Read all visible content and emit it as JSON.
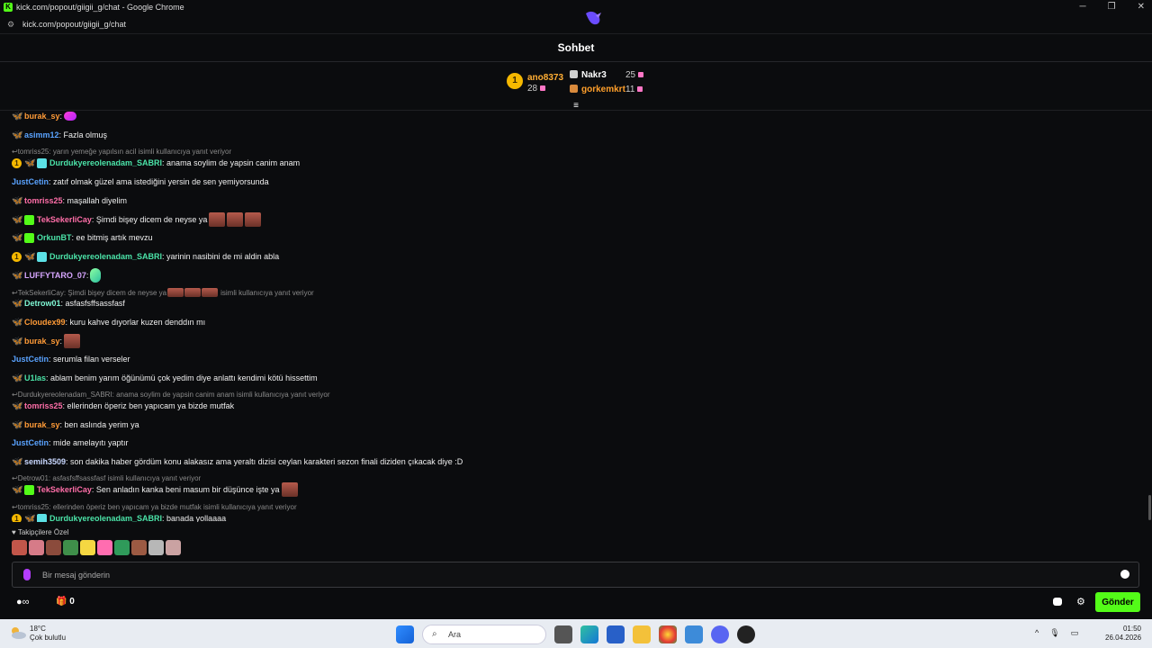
{
  "window": {
    "title": "kick.com/popout/giigii_g/chat - Google Chrome",
    "url": "kick.com/popout/giigii_g/chat"
  },
  "chat_header": {
    "title": "Sohbet"
  },
  "leaderboard": {
    "first": {
      "rank": "1",
      "name": "ano8373",
      "count": "28"
    },
    "others": [
      {
        "name": "Nakr3",
        "count": "25",
        "color": "#ffffff"
      },
      {
        "name": "gorkemkrt",
        "count": "11",
        "color": "#ff9f2b"
      }
    ]
  },
  "messages": [
    {
      "kind": "msg",
      "badges": [
        "fly"
      ],
      "user": "burak_sy",
      "color": "#ff9b37",
      "text": ":",
      "emotes": [
        "p"
      ]
    },
    {
      "kind": "msg",
      "badges": [
        "fly-y"
      ],
      "user": "asimm12",
      "color": "#5aa3ff",
      "text": ": Fazla olmuş",
      "emotes": []
    },
    {
      "kind": "reply",
      "text": "tomriss25: yarın yemeğe yapılsın acil isimli kullanıcıya yanıt veriyor",
      "emotes": []
    },
    {
      "kind": "msg",
      "badges": [
        "one",
        "fly-o",
        "sub"
      ],
      "user": "Durdukyereolenadam_SABRI",
      "color": "#4be3a8",
      "text": ": anama soylim de yapsin canim anam",
      "emotes": []
    },
    {
      "kind": "msg",
      "badges": [],
      "user": "JustCetin",
      "color": "#5aa3ff",
      "text": ": zatıf olmak güzel ama istediğini yersin de sen yemiyorsunda",
      "emotes": []
    },
    {
      "kind": "msg",
      "badges": [
        "fly-y"
      ],
      "user": "tomriss25",
      "color": "#ff6ea8",
      "text": ": maşallah diyelim",
      "emotes": []
    },
    {
      "kind": "msg",
      "badges": [
        "fly",
        "gift"
      ],
      "user": "TekSekerliCay",
      "color": "#ff6ea8",
      "text": ": Şimdi bişey dicem de neyse ya",
      "emotes": [
        "r",
        "r",
        "r"
      ]
    },
    {
      "kind": "msg",
      "badges": [
        "fly",
        "gift"
      ],
      "user": "OrkunBT",
      "color": "#4be3a8",
      "text": ": ee bitmiş artık mevzu",
      "emotes": []
    },
    {
      "kind": "msg",
      "badges": [
        "one",
        "fly-o",
        "sub"
      ],
      "user": "Durdukyereolenadam_SABRI",
      "color": "#4be3a8",
      "text": ": yarinin nasibini de mi aldin abla",
      "emotes": []
    },
    {
      "kind": "msg",
      "badges": [
        "fly"
      ],
      "user": "LUFFYTARO_07",
      "color": "#d7a6ff",
      "text": ":",
      "emotes": [
        "g"
      ]
    },
    {
      "kind": "reply",
      "text": "TekSekerliCay: Şimdi bişey dicem de neyse ya",
      "suffix": "isimli kullanıcıya yanıt veriyor",
      "emotes": [
        "r",
        "r",
        "r"
      ]
    },
    {
      "kind": "msg",
      "badges": [
        "fly-o"
      ],
      "user": "Detrow01",
      "color": "#7ff7d4",
      "text": ": asfasfsffsassfasf",
      "emotes": []
    },
    {
      "kind": "msg",
      "badges": [
        "fly-o"
      ],
      "user": "Cloudex99",
      "color": "#ff9b37",
      "text": ": kuru kahve dıyorlar kuzen denddın mı",
      "emotes": []
    },
    {
      "kind": "msg",
      "badges": [
        "fly"
      ],
      "user": "burak_sy",
      "color": "#ff9b37",
      "text": ":",
      "emotes": [
        "r"
      ]
    },
    {
      "kind": "msg",
      "badges": [],
      "user": "JustCetin",
      "color": "#5aa3ff",
      "text": ": serumla filan verseler",
      "emotes": []
    },
    {
      "kind": "msg",
      "badges": [
        "fly"
      ],
      "user": "U1las",
      "color": "#4be3a8",
      "text": ": ablam benim yarım öğünümü çok yedim diye anlattı kendimi kötü hissettim",
      "emotes": []
    },
    {
      "kind": "reply",
      "text": "Durdukyereolenadam_SABRI: anama soylim de yapsin canim anam isimli kullanıcıya yanıt veriyor",
      "emotes": []
    },
    {
      "kind": "msg",
      "badges": [
        "fly-y"
      ],
      "user": "tomriss25",
      "color": "#ff6ea8",
      "text": ": ellerinden öperiz ben yapıcam ya bizde mutfak",
      "emotes": []
    },
    {
      "kind": "msg",
      "badges": [
        "fly"
      ],
      "user": "burak_sy",
      "color": "#ff9b37",
      "text": ": ben aslında yerim ya",
      "emotes": []
    },
    {
      "kind": "msg",
      "badges": [],
      "user": "JustCetin",
      "color": "#5aa3ff",
      "text": ": mide amelayıtı yaptır",
      "emotes": []
    },
    {
      "kind": "msg",
      "badges": [
        "fly"
      ],
      "user": "semih3509",
      "color": "#c9d8ff",
      "text": ": son dakika haber gördüm konu alakasız ama yeraltı dizisi ceylan karakteri sezon finali diziden çıkacak diye :D",
      "emotes": []
    },
    {
      "kind": "reply",
      "text": "Detrow01: asfasfsffsassfasf isimli kullanıcıya yanıt veriyor",
      "emotes": []
    },
    {
      "kind": "msg",
      "badges": [
        "fly",
        "gift"
      ],
      "user": "TekSekerliCay",
      "color": "#ff6ea8",
      "text": ": Sen anladın kanka beni masum bir düşünce işte ya",
      "emotes": [
        "r"
      ]
    },
    {
      "kind": "reply",
      "text": "tomriss25: ellerinden öperiz ben yapıcam ya bizde mutfak isimli kullanıcıya yanıt veriyor",
      "emotes": []
    },
    {
      "kind": "msg",
      "badges": [
        "one",
        "fly-o",
        "sub"
      ],
      "user": "Durdukyereolenadam_SABRI",
      "color": "#4be3a8",
      "text": ": banada yollaaaa",
      "emotes": []
    }
  ],
  "emote_picker": {
    "label": "Takipçilere Özel",
    "emote_colors": [
      "#c2564a",
      "#d67b88",
      "#8b4b3c",
      "#3f8f4a",
      "#f5d742",
      "#ff6db0",
      "#2f9a5a",
      "#9c5a43",
      "#b7b7b7",
      "#caa2a2"
    ]
  },
  "input": {
    "placeholder": "Bir mesaj gönderin"
  },
  "bottom": {
    "points": "0",
    "send_label": "Gönder"
  },
  "taskbar": {
    "temp": "18°C",
    "weather": "Çok bulutlu",
    "search": "Ara",
    "time": "01:50",
    "date": "26.04.2026"
  }
}
